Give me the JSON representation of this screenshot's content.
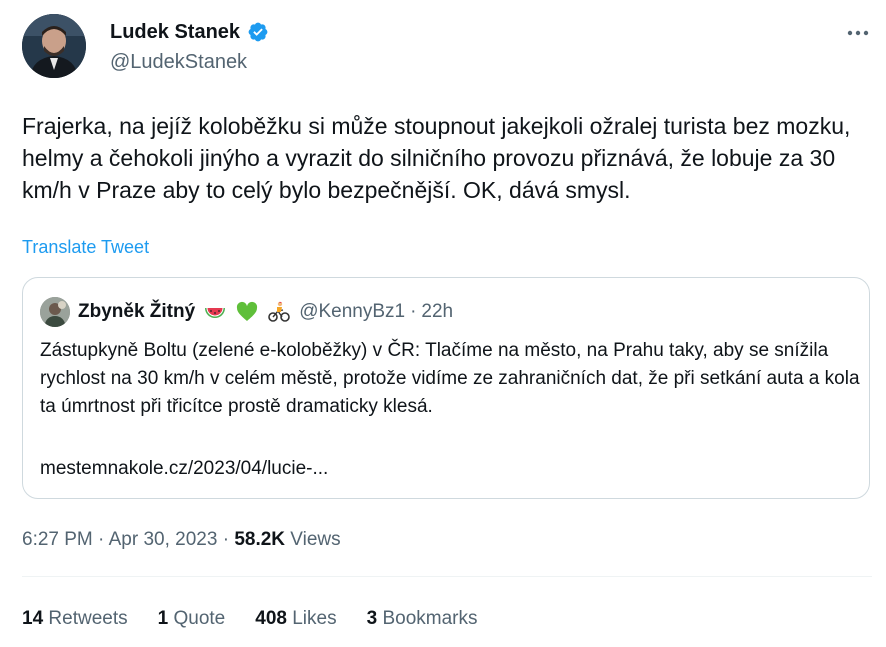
{
  "author": {
    "name": "Ludek Stanek",
    "handle": "@LudekStanek"
  },
  "tweet": {
    "text": "Frajerka, na jejíž koloběžku si může stoupnout jakejkoli ožralej turista bez mozku, helmy a čehokoli jinýho a vyrazit do silničního provozu přiznává, že lobuje za 30 km/h v Praze aby to celý bylo bezpečnější. OK, dává smysl.",
    "translate_label": "Translate Tweet"
  },
  "quote": {
    "name": "Zbyněk Žitný",
    "emojis": [
      "watermelon-icon",
      "green-heart-icon",
      "cyclist-icon"
    ],
    "handle": "@KennyBz1",
    "separator": "·",
    "time": "22h",
    "text": "Zástupkyně Boltu (zelené e-koloběžky) v ČR: Tlačíme na město, na Prahu taky, aby se snížila rychlost na 30 km/h v celém městě, protože vidíme ze zahraničních dat, že při setkání auta a kola ta úmrtnost při třicítce prostě dramaticky klesá.",
    "link": "mestemnakole.cz/2023/04/lucie-..."
  },
  "meta": {
    "time": "6:27 PM",
    "sep1": "·",
    "date": "Apr 30, 2023",
    "sep2": "·",
    "views_count": "58.2K",
    "views_label": "Views"
  },
  "stats": {
    "retweets_count": "14",
    "retweets_label": "Retweets",
    "quotes_count": "1",
    "quotes_label": "Quote",
    "likes_count": "408",
    "likes_label": "Likes",
    "bookmarks_count": "3",
    "bookmarks_label": "Bookmarks"
  },
  "colors": {
    "link": "#1d9bf0",
    "secondary_text": "#536471",
    "primary_text": "#0f1419",
    "border": "#cfd9de",
    "verified": "#1d9bf0"
  }
}
